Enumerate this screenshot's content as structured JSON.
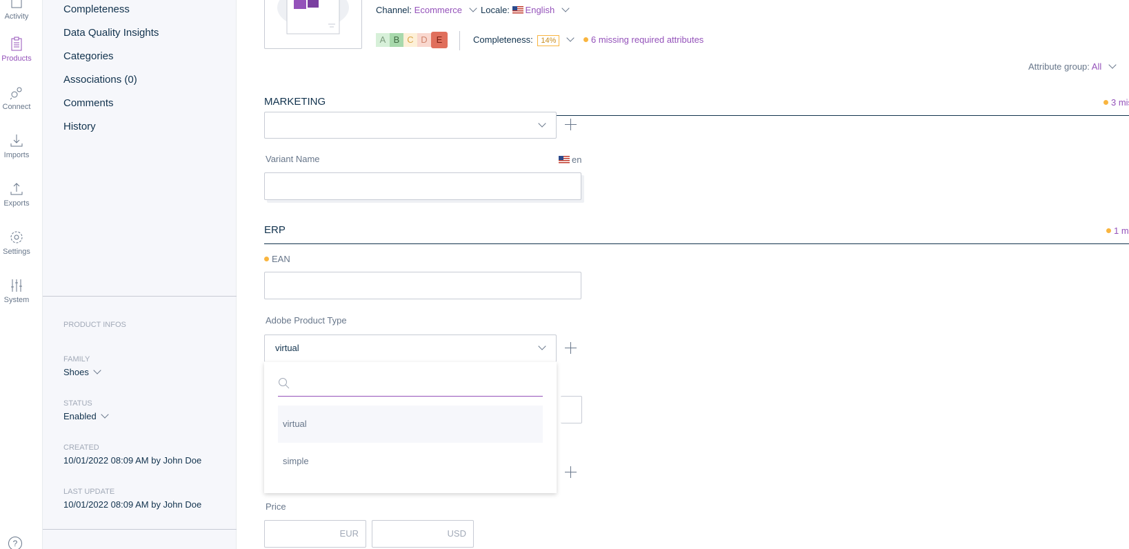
{
  "main_menu": {
    "items": [
      {
        "label": "Activity",
        "icon": "activity-icon"
      },
      {
        "label": "Products",
        "icon": "clipboard-icon",
        "active": true
      },
      {
        "label": "Connect",
        "icon": "plug-icon"
      },
      {
        "label": "Imports",
        "icon": "import-icon"
      },
      {
        "label": "Exports",
        "icon": "export-icon"
      },
      {
        "label": "Settings",
        "icon": "gear-icon"
      },
      {
        "label": "System",
        "icon": "sliders-icon"
      }
    ],
    "help_label": "?"
  },
  "column": {
    "nav": [
      "Completeness",
      "Data Quality Insights",
      "Categories",
      "Associations (0)",
      "Comments",
      "History"
    ],
    "product_infos_title": "PRODUCT INFOS",
    "family": {
      "label": "FAMILY",
      "value": "Shoes"
    },
    "status": {
      "label": "STATUS",
      "value": "Enabled"
    },
    "created": {
      "label": "CREATED",
      "value": "10/01/2022 08:09 AM by John Doe"
    },
    "last_update": {
      "label": "LAST UPDATE",
      "value": "10/01/2022 08:09 AM by John Doe"
    }
  },
  "header": {
    "channel_label": "Channel:",
    "channel_value": "Ecommerce",
    "locale_label": "Locale:",
    "locale_value": "English",
    "dqi_grades": [
      "A",
      "B",
      "C",
      "D",
      "E"
    ],
    "completeness_label": "Completeness:",
    "completeness_value": "14%",
    "missing_required": "6 missing required attributes",
    "attribute_group_label": "Attribute group:",
    "attribute_group_value": "All"
  },
  "sections": {
    "marketing": {
      "title": "MARKETING",
      "missing": "3 mis"
    },
    "erp": {
      "title": "ERP",
      "missing": "1 m"
    }
  },
  "fields": {
    "variant_name_label": "Variant Name",
    "variant_name_locale": "en",
    "ean_label": "EAN",
    "adobe_product_type_label": "Adobe Product Type",
    "adobe_product_type_value": "virtual",
    "price_label": "Price",
    "price_currencies": [
      "EUR",
      "USD"
    ]
  },
  "dropdown": {
    "search_value": "",
    "options": [
      "virtual",
      "simple"
    ]
  },
  "colors": {
    "accent": "#9452ba",
    "warning": "#f9b53f",
    "text": "#11324d"
  }
}
